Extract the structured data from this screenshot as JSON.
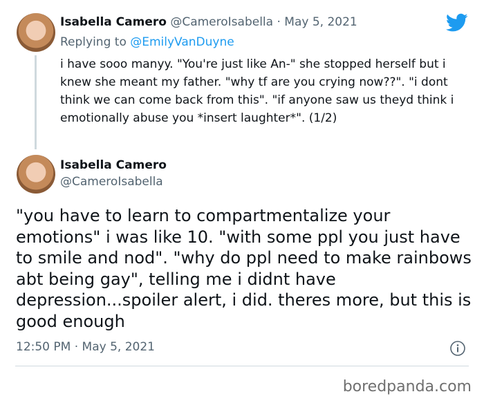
{
  "tweet1": {
    "name": "Isabella Camero",
    "handle": "@CameroIsabella",
    "separator": "·",
    "date": "May 5, 2021",
    "reply_prefix": "Replying to",
    "reply_handle": "@EmilyVanDuyne",
    "text": "i have sooo manyy. \"You're just like An-\" she stopped herself but i knew she meant my father. \"why tf are you crying now??\". \"i dont think we can come back from this\". \"if anyone saw us theyd think i emotionally abuse you *insert laughter*\". (1/2)"
  },
  "tweet2": {
    "name": "Isabella Camero",
    "handle": "@CameroIsabella",
    "text": "\"you have to learn to compartmentalize your emotions\" i was like 10. \"with some ppl you just have to smile and nod\". \"why do ppl need to make rainbows abt being gay\", telling me i didnt have depression...spoiler alert, i did. theres more, but this is good enough",
    "time": "12:50 PM",
    "separator": "·",
    "date": "May 5, 2021"
  },
  "icons": {
    "brand": "twitter-bird-icon",
    "info": "info-icon"
  },
  "colors": {
    "accent": "#1d9bf0",
    "muted": "#536471"
  },
  "watermark": "boredpanda.com"
}
